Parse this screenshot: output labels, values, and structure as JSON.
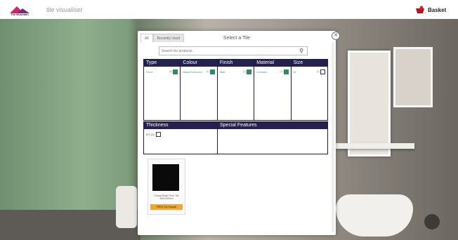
{
  "header": {
    "logo_text": "Tile Mountain",
    "app_title": "tile visualiser",
    "basket_label": "Basket",
    "basket_icon": "basket-icon"
  },
  "modal": {
    "tabs": [
      {
        "label": "All"
      },
      {
        "label": "Recently Used"
      }
    ],
    "title": "Select a Tile",
    "close_icon": "close-icon",
    "search": {
      "placeholder": "Search for products",
      "icon": "search-icon"
    },
    "filters": [
      {
        "heading": "Type",
        "option": {
          "label": "Floor",
          "count": "(6)",
          "checked": true
        }
      },
      {
        "heading": "Colour",
        "option": {
          "label": "Black/Coloured",
          "count": "(1)",
          "checked": true
        }
      },
      {
        "heading": "Finish",
        "option": {
          "label": "Matt",
          "count": "(1)",
          "checked": true
        }
      },
      {
        "heading": "Material",
        "option": {
          "label": "Ceramic",
          "count": "(1)",
          "checked": true
        }
      },
      {
        "heading": "Size",
        "option": {
          "label": "M",
          "count": "(1)",
          "checked": false
        }
      }
    ],
    "thickness": {
      "heading": "Thickness",
      "option": {
        "label": "6.0 (1)",
        "checked": false
      }
    },
    "special_features": {
      "heading": "Special Features"
    },
    "product": {
      "name": "Cheap Black Floor Tile 150x300mm",
      "button": "FREE Cut Sample"
    }
  },
  "colors": {
    "accent": "#24214f",
    "check": "#2e8b66",
    "sample_button": "#f2a62c"
  }
}
